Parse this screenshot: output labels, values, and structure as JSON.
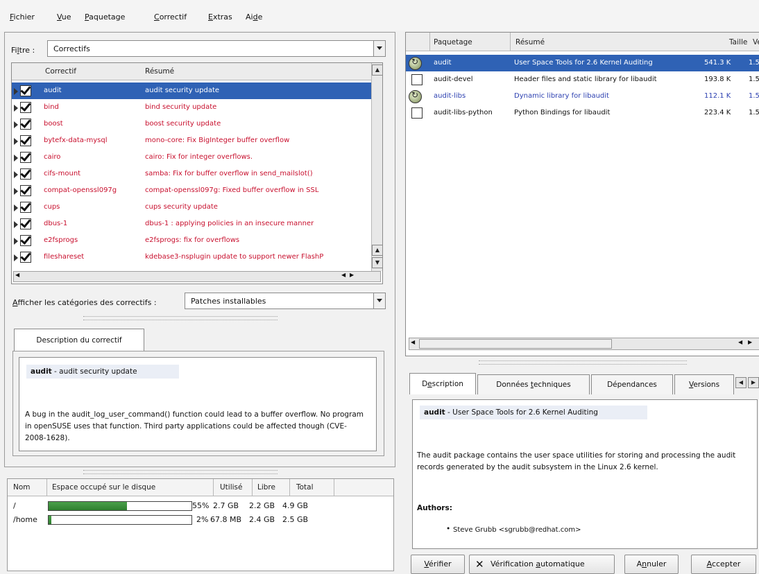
{
  "menu": [
    {
      "pre": "",
      "ul": "F",
      "post": "ichier"
    },
    {
      "pre": "",
      "ul": "V",
      "post": "ue"
    },
    {
      "pre": "",
      "ul": "P",
      "post": "aquetage"
    },
    {
      "pre": "",
      "ul": "C",
      "post": "orrectif"
    },
    {
      "pre": "",
      "ul": "E",
      "post": "xtras"
    },
    {
      "pre": "Ai",
      "ul": "d",
      "post": "e"
    }
  ],
  "filter": {
    "label_pre": "Fi",
    "label_ul": "l",
    "label_post": "tre :",
    "value": "Correctifs"
  },
  "patch_table": {
    "headers": [
      "Correctif",
      "Résumé"
    ],
    "rows": [
      {
        "name": "audit",
        "summary": "audit security update",
        "checked": true,
        "selected": true
      },
      {
        "name": "bind",
        "summary": "bind security update",
        "checked": true
      },
      {
        "name": "boost",
        "summary": "boost security update",
        "checked": true
      },
      {
        "name": "bytefx-data-mysql",
        "summary": "mono-core: Fix BigInteger buffer overflow",
        "checked": true
      },
      {
        "name": "cairo",
        "summary": "cairo: Fix for integer overflows.",
        "checked": true
      },
      {
        "name": "cifs-mount",
        "summary": "samba: Fix for buffer overflow in send_mailslot()",
        "checked": true
      },
      {
        "name": "compat-openssl097g",
        "summary": "compat-openssl097g: Fixed buffer overflow in SSL",
        "checked": true
      },
      {
        "name": "cups",
        "summary": "cups security update",
        "checked": true
      },
      {
        "name": "dbus-1",
        "summary": "dbus-1 : applying policies in an insecure manner",
        "checked": true
      },
      {
        "name": "e2fsprogs",
        "summary": "e2fsprogs: fix for overflows",
        "checked": true
      },
      {
        "name": "fileshareset",
        "summary": "kdebase3-nsplugin update to support newer FlashP",
        "checked": true
      }
    ]
  },
  "categories": {
    "label_pre": "",
    "label_ul": "A",
    "label_post": "fficher les catégories des correctifs :",
    "value": "Patches installables"
  },
  "patch_desc": {
    "tab": "Description du correctif",
    "title_bold": "audit",
    "title_rest": " - audit security update",
    "body": "A bug in the audit_log_user_command() function could lead to a buffer overflow. No program in openSUSE uses that function. Third party applications could be affected though (CVE-2008-1628)."
  },
  "disk": {
    "headers": [
      "Nom",
      "Espace occupé sur le disque",
      "Utilisé",
      "Libre",
      "Total"
    ],
    "rows": [
      {
        "name": "/",
        "percent_text": "55%",
        "fill": 0.55,
        "used": "2.7 GB",
        "free": "2.2 GB",
        "total": "4.9 GB"
      },
      {
        "name": "/home",
        "percent_text": "2%",
        "fill": 0.02,
        "used": "67.8 MB",
        "free": "2.4 GB",
        "total": "2.5 GB"
      }
    ]
  },
  "package_table": {
    "headers": [
      "Paquetage",
      "Résumé",
      "Taille",
      "Ve"
    ],
    "rows": [
      {
        "name": "audit",
        "summary": "User Space Tools for 2.6 Kernel Auditing",
        "size": "541.3 K",
        "ver": "1.5",
        "icon": "update",
        "selected": true
      },
      {
        "name": "audit-devel",
        "summary": "Header files and static library for libaudit",
        "size": "193.8 K",
        "ver": "1.5",
        "icon": "none"
      },
      {
        "name": "audit-libs",
        "summary": "Dynamic library for libaudit",
        "size": "112.1 K",
        "ver": "1.5",
        "icon": "update"
      },
      {
        "name": "audit-libs-python",
        "summary": "Python Bindings for libaudit",
        "size": "223.4 K",
        "ver": "1.5",
        "icon": "none"
      }
    ]
  },
  "pkg_tabs": [
    {
      "pre": "D",
      "ul": "e",
      "post": "scription"
    },
    {
      "pre": "Données ",
      "ul": "t",
      "post": "echniques"
    },
    {
      "pre": "Dépendances",
      "ul": "",
      "post": ""
    },
    {
      "pre": "",
      "ul": "V",
      "post": "ersions"
    }
  ],
  "pkg_desc": {
    "title_bold": "audit",
    "title_rest": " - User Space Tools for 2.6 Kernel Auditing",
    "body": "The audit package contains the user space utilities for storing and processing the audit records generated by the audit subsystem in the Linux 2.6 kernel.",
    "authors_label": "Authors:",
    "author": "Steve Grubb <sgrubb@redhat.com>"
  },
  "buttons": {
    "verify": {
      "pre": "",
      "ul": "V",
      "post": "érifier"
    },
    "auto": {
      "pre": "Vérification ",
      "ul": "a",
      "post": "utomatique"
    },
    "cancel": {
      "pre": "A",
      "ul": "n",
      "post": "nuler"
    },
    "accept": {
      "pre": "",
      "ul": "A",
      "post": "ccepter"
    }
  },
  "colors": {
    "selection": "#2f62b5",
    "patch_text": "#c8102e",
    "lib_text": "#2b3fb0",
    "bar_fill": "#3a8f3a"
  }
}
